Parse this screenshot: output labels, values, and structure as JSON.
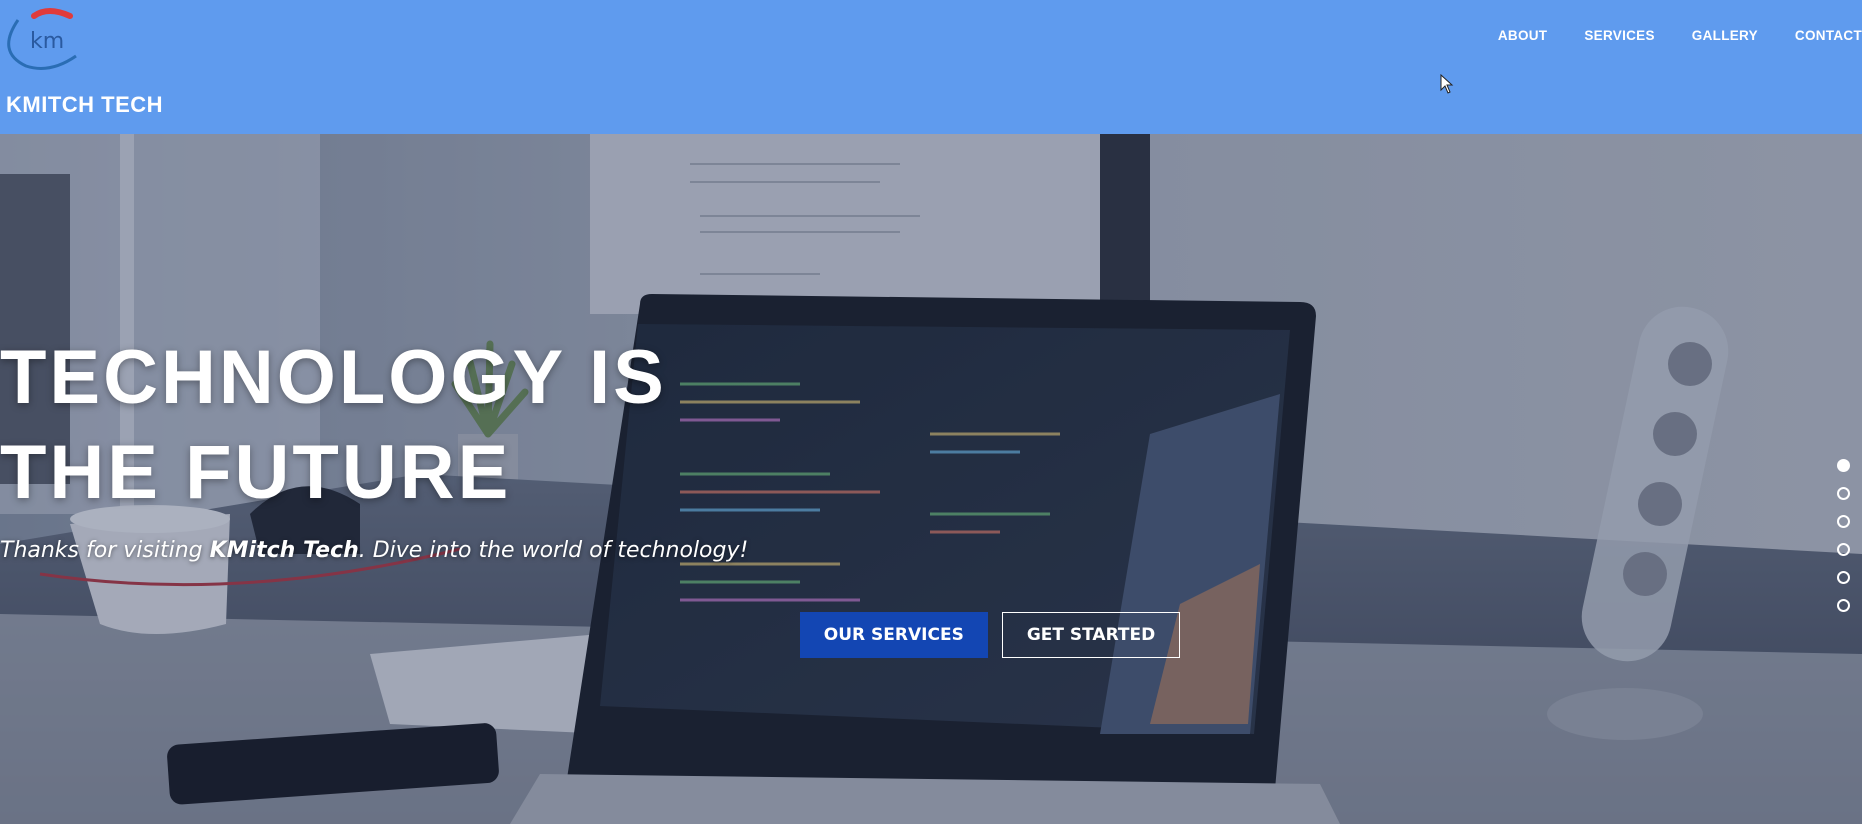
{
  "header": {
    "logo_text": "km",
    "brand": "KMITCH TECH"
  },
  "nav": {
    "items": [
      "ABOUT",
      "SERVICES",
      "GALLERY",
      "CONTACT"
    ]
  },
  "hero": {
    "title_line1": "TECHNOLOGY IS",
    "title_line2": "THE FUTURE",
    "subtitle_before": "Thanks for visiting ",
    "subtitle_bold": "KMitch Tech",
    "subtitle_after": ". Dive into the world of technology!",
    "primary_button": "OUR SERVICES",
    "secondary_button": "GET STARTED"
  },
  "slider": {
    "dot_count": 6,
    "active_index": 0
  },
  "colors": {
    "header_bg": "#5f9bee",
    "primary_button": "#1346b3",
    "logo_red": "#e03b3b",
    "logo_blue": "#2a6db4"
  },
  "icons": {
    "logo": "km-logo-icon",
    "cursor": "mouse-pointer-icon"
  }
}
